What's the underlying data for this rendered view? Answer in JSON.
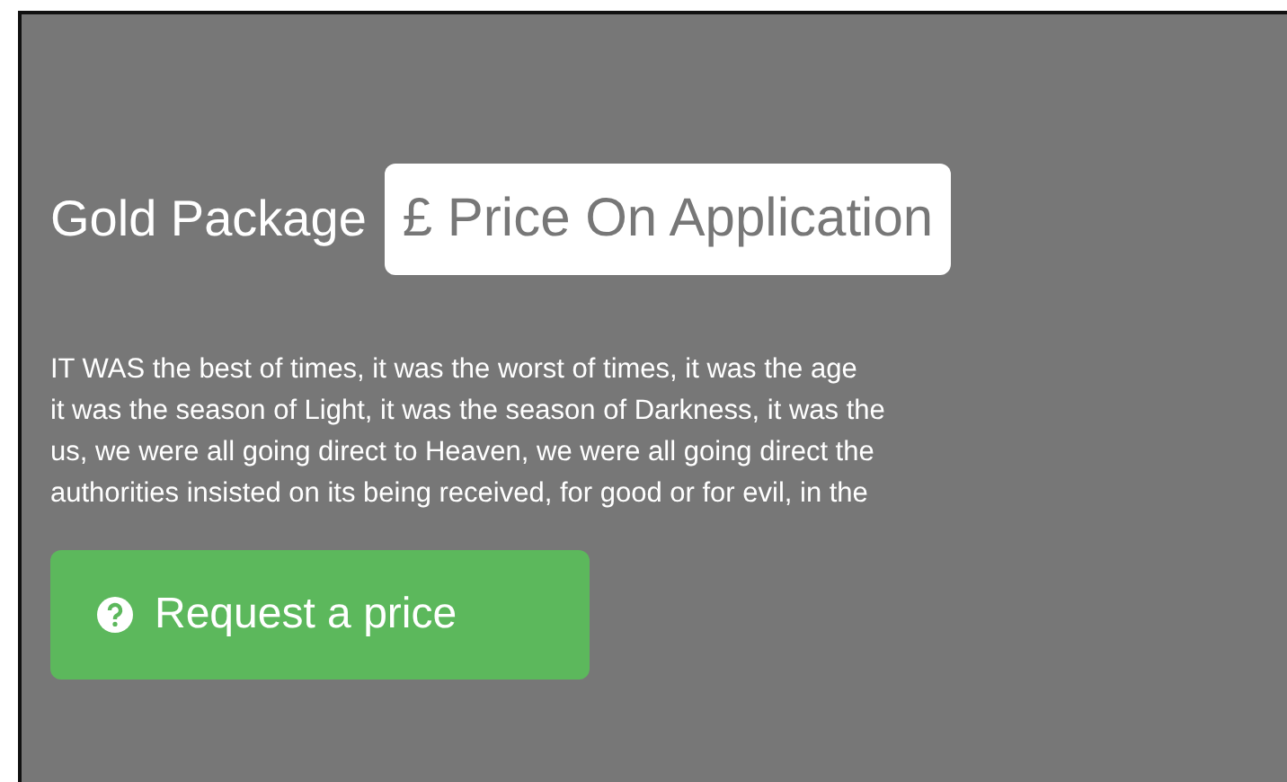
{
  "package": {
    "name": "Gold Package",
    "price": "£ Price On Application"
  },
  "description": [
    "IT WAS the best of times, it was the worst of times, it was the age",
    "it was the season of Light, it was the season of Darkness, it was the",
    "us, we were all going direct to Heaven, we were all going direct the",
    "authorities insisted on its being received, for good or for evil, in the"
  ],
  "button": {
    "label": "Request a price"
  }
}
